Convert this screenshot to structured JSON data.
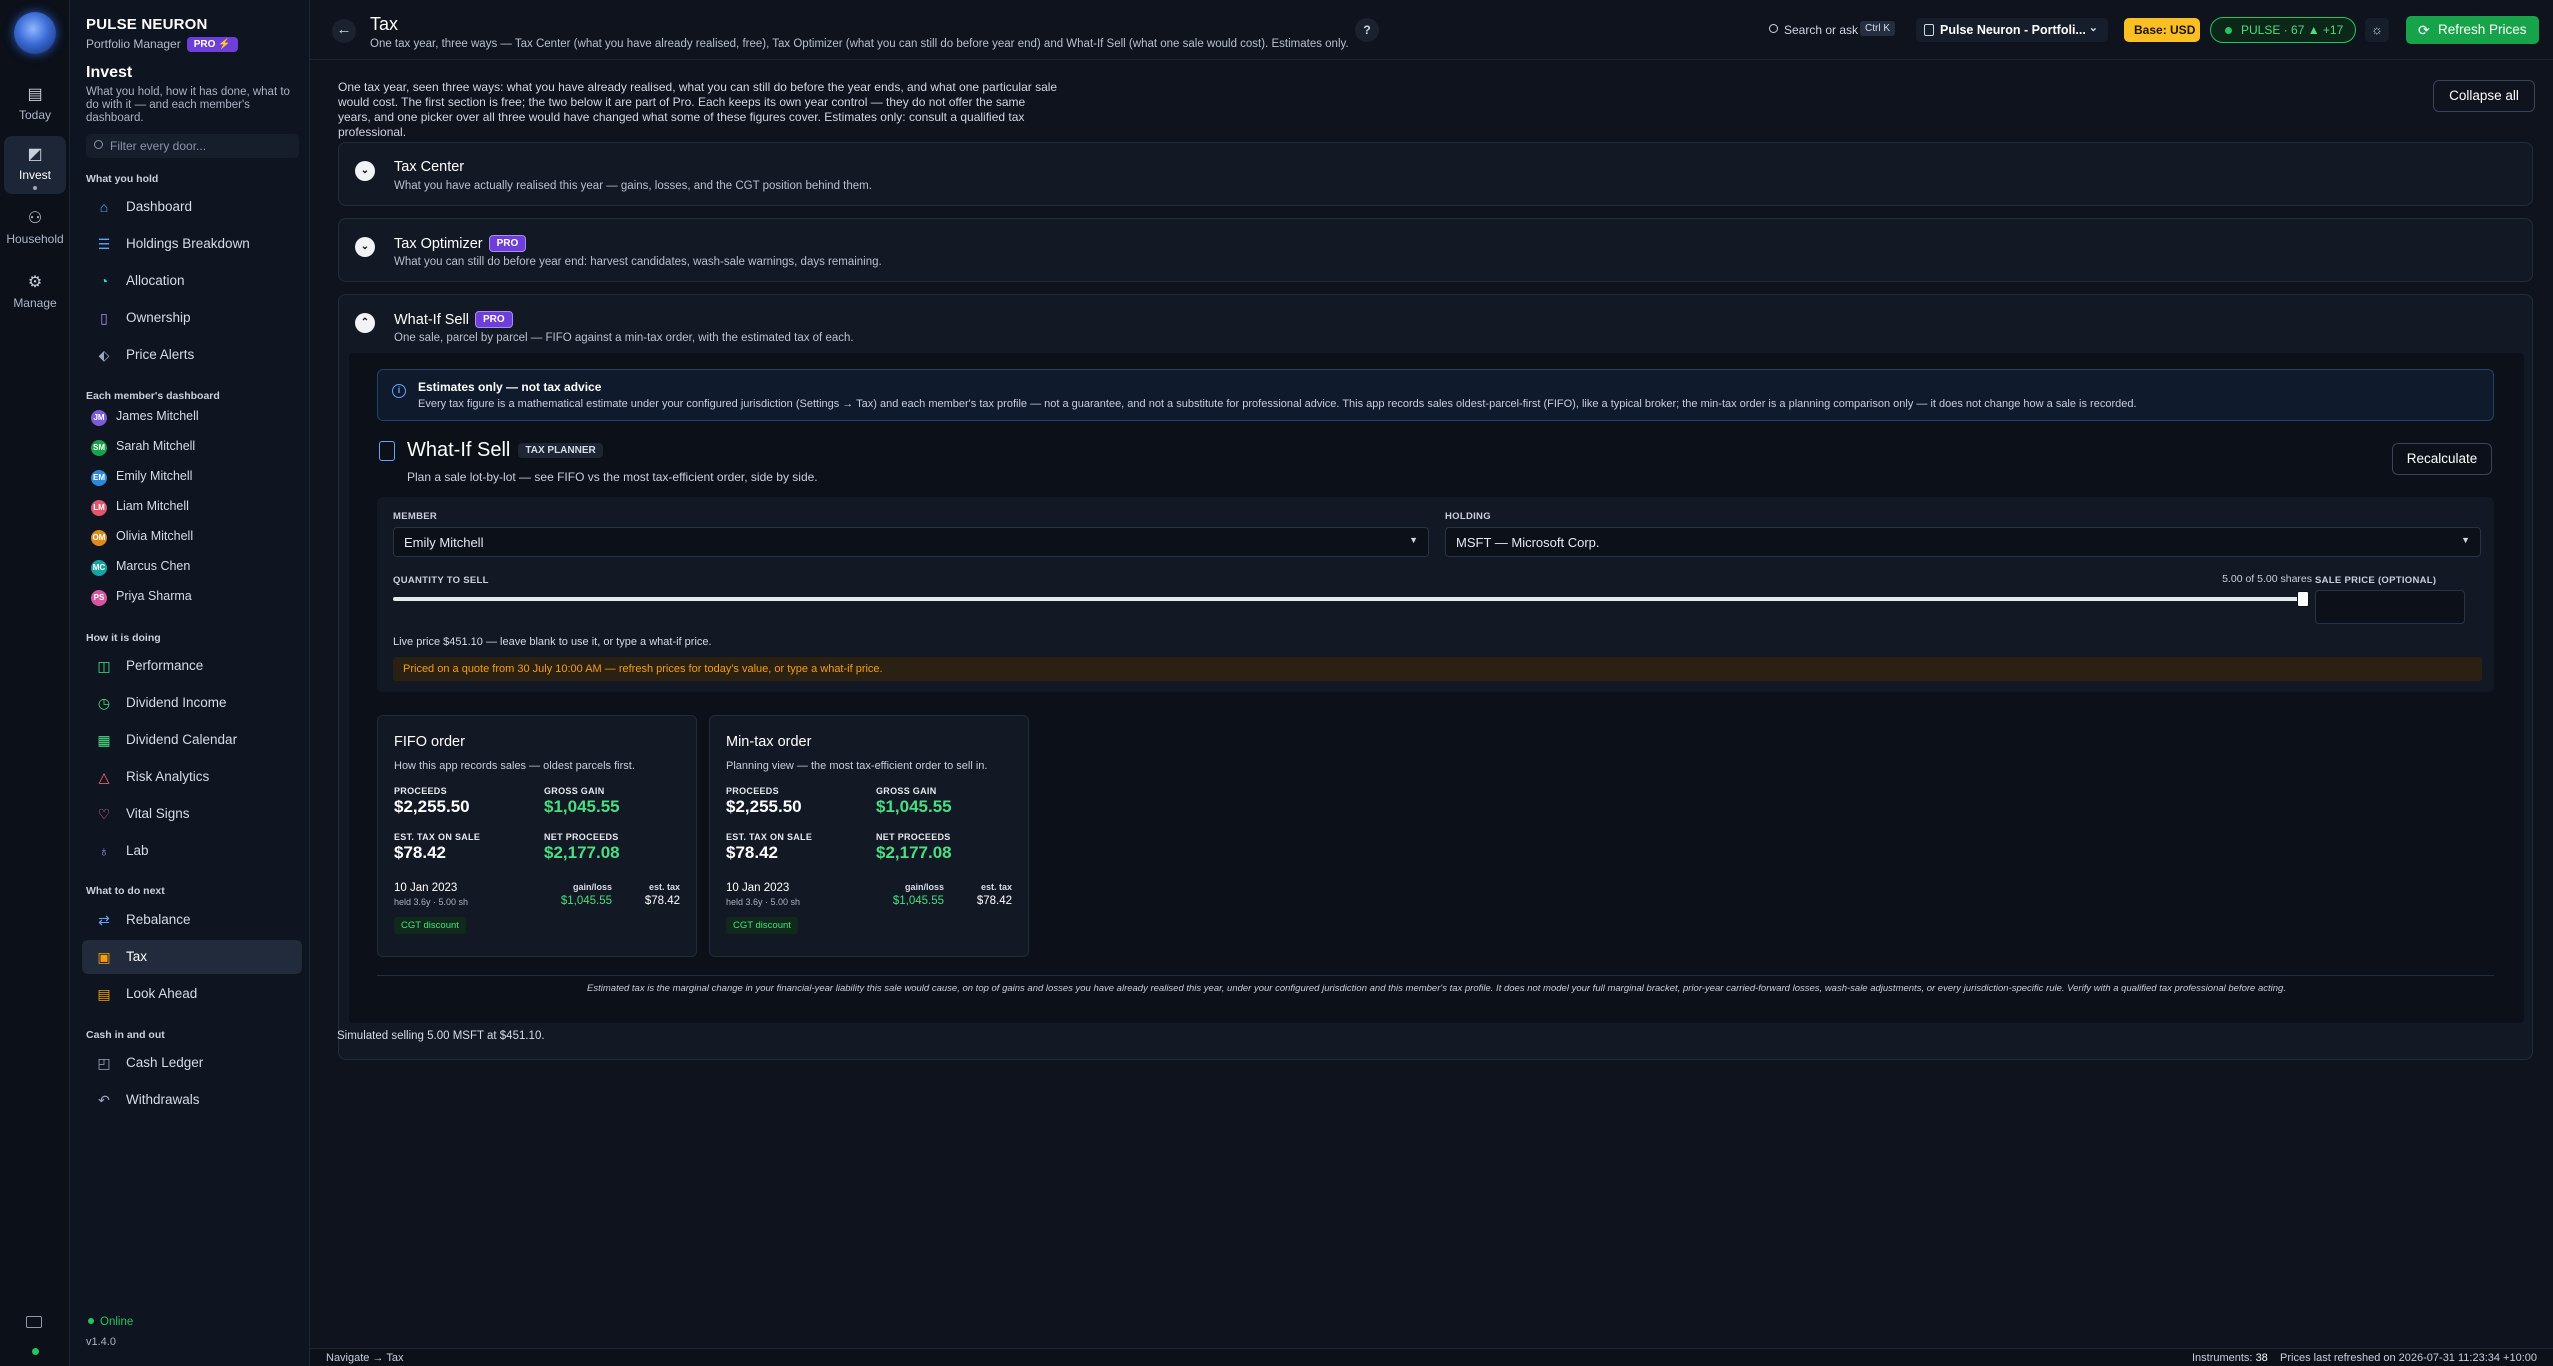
{
  "rail": {
    "items": [
      {
        "label": "Today",
        "icon": "today-icon"
      },
      {
        "label": "Invest",
        "icon": "invest-icon"
      },
      {
        "label": "Household",
        "icon": "household-icon"
      },
      {
        "label": "Manage",
        "icon": "manage-icon"
      }
    ]
  },
  "sidebar": {
    "brand": "PULSE NEURON",
    "subtitle": "Portfolio Manager",
    "pro": "PRO ⚡",
    "section_title": "Invest",
    "section_desc": "What you hold, how it has done, what to do with it — and each member's dashboard.",
    "filter_placeholder": "Filter every door...",
    "groups": {
      "hold": "What you hold",
      "members": "Each member's dashboard",
      "doing": "How it is doing",
      "next": "What to do next",
      "cash": "Cash in and out"
    },
    "hold_items": [
      "Dashboard",
      "Holdings Breakdown",
      "Allocation",
      "Ownership",
      "Price Alerts"
    ],
    "members": [
      {
        "initials": "JM",
        "name": "James Mitchell",
        "color": "#7c5cd6"
      },
      {
        "initials": "SM",
        "name": "Sarah Mitchell",
        "color": "#16a34a"
      },
      {
        "initials": "EM",
        "name": "Emily Mitchell",
        "color": "#2b8ad8"
      },
      {
        "initials": "LM",
        "name": "Liam Mitchell",
        "color": "#e0566b"
      },
      {
        "initials": "OM",
        "name": "Olivia Mitchell",
        "color": "#e08a1c"
      },
      {
        "initials": "MC",
        "name": "Marcus Chen",
        "color": "#16a3a3"
      },
      {
        "initials": "PS",
        "name": "Priya Sharma",
        "color": "#d6569f"
      }
    ],
    "doing_items": [
      "Performance",
      "Dividend Income",
      "Dividend Calendar",
      "Risk Analytics",
      "Vital Signs",
      "Lab"
    ],
    "next_items": [
      "Rebalance",
      "Tax",
      "Look Ahead"
    ],
    "cash_items": [
      "Cash Ledger",
      "Withdrawals"
    ],
    "online": "Online",
    "version": "v1.4.0"
  },
  "header": {
    "title": "Tax",
    "subtitle": "One tax year, three ways — Tax Center (what you have already realised, free), Tax Optimizer (what you can still do before year end) and What-If Sell (what one sale would cost). Estimates only.",
    "help": "?",
    "search": "Search or ask",
    "search_kbd": "Ctrl K",
    "workspace": "Pulse Neuron - Portfoli...",
    "base": "Base: USD",
    "pulse": "PULSE · 67  ▲ +17",
    "refresh": "Refresh Prices"
  },
  "intro": "One tax year, seen three ways: what you have already realised, what you can still do before the year ends, and what one particular sale would cost. The first section is free; the two below it are part of Pro. Each keeps its own year control — they do not offer the same years, and one picker over all three would have changed what some of these figures cover. Estimates only: consult a qualified tax professional.",
  "collapse_all": "Collapse all",
  "sections": [
    {
      "title": "Tax Center",
      "desc": "What you have actually realised this year — gains, losses, and the CGT position behind them.",
      "pro": ""
    },
    {
      "title": "Tax Optimizer",
      "desc": "What you can still do before year end: harvest candidates, wash-sale warnings, days remaining.",
      "pro": "PRO"
    },
    {
      "title": "What-If Sell",
      "desc": "One sale, parcel by parcel — FIFO against a min-tax order, with the estimated tax of each.",
      "pro": "PRO"
    }
  ],
  "warning": {
    "title": "Estimates only — not tax advice",
    "text": "Every tax figure is a mathematical estimate under your configured jurisdiction (Settings → Tax) and each member's tax profile — not a guarantee, and not a substitute for professional advice. This app records sales oldest-parcel-first (FIFO), like a typical broker; the min-tax order is a planning comparison only — it does not change how a sale is recorded."
  },
  "whatif": {
    "title": "What-If Sell",
    "tag": "TAX PLANNER",
    "desc": "Plan a sale lot-by-lot — see FIFO vs the most tax-efficient order, side by side.",
    "recalc": "Recalculate",
    "member_label": "MEMBER",
    "member_value": "Emily Mitchell",
    "holding_label": "HOLDING",
    "holding_value": "MSFT — Microsoft Corp.",
    "qty_label": "QUANTITY TO SELL",
    "qty_value": "5.00 of 5.00 shares",
    "qty_fraction": 1.0,
    "price_label": "SALE PRICE (OPTIONAL)",
    "live_price": "Live price $451.10 — leave blank to use it, or type a what-if price.",
    "quote_note": "Priced on a quote from 30 July 10:00 AM — refresh prices for today's value, or type a what-if price."
  },
  "cards": [
    {
      "title": "FIFO order",
      "desc": "How this app records sales — oldest parcels first.",
      "proceeds_label": "PROCEEDS",
      "proceeds": "$2,255.50",
      "gain_label": "GROSS GAIN",
      "gain": "$1,045.55",
      "tax_label": "EST. TAX ON SALE",
      "tax": "$78.42",
      "net_label": "NET PROCEEDS",
      "net": "$2,177.08",
      "parcel_date": "10 Jan 2023",
      "parcel_meta": "held 3.6y · 5.00 sh",
      "gl_label": "gain/loss",
      "gl_value": "$1,045.55",
      "et_label": "est. tax",
      "et_value": "$78.42",
      "badge": "CGT discount"
    },
    {
      "title": "Min-tax order",
      "desc": "Planning view — the most tax-efficient order to sell in.",
      "proceeds_label": "PROCEEDS",
      "proceeds": "$2,255.50",
      "gain_label": "GROSS GAIN",
      "gain": "$1,045.55",
      "tax_label": "EST. TAX ON SALE",
      "tax": "$78.42",
      "net_label": "NET PROCEEDS",
      "net": "$2,177.08",
      "parcel_date": "10 Jan 2023",
      "parcel_meta": "held 3.6y · 5.00 sh",
      "gl_label": "gain/loss",
      "gl_value": "$1,045.55",
      "et_label": "est. tax",
      "et_value": "$78.42",
      "badge": "CGT discount"
    }
  ],
  "footnote": "Estimated tax is the marginal change in your financial-year liability this sale would cause, on top of gains and losses you have already realised this year, under your configured jurisdiction and this member's tax profile. It does not model your full marginal bracket, prior-year carried-forward losses, wash-sale adjustments, or every jurisdiction-specific rule. Verify with a qualified tax professional before acting.",
  "simulated": "Simulated selling 5.00 MSFT at $451.10.",
  "status": {
    "breadcrumb": "Navigate → Tax",
    "instruments_label": "Instruments:",
    "instruments": "38",
    "last_refreshed": "Prices last refreshed on 2026-07-31 11:23:34 +10:00"
  }
}
